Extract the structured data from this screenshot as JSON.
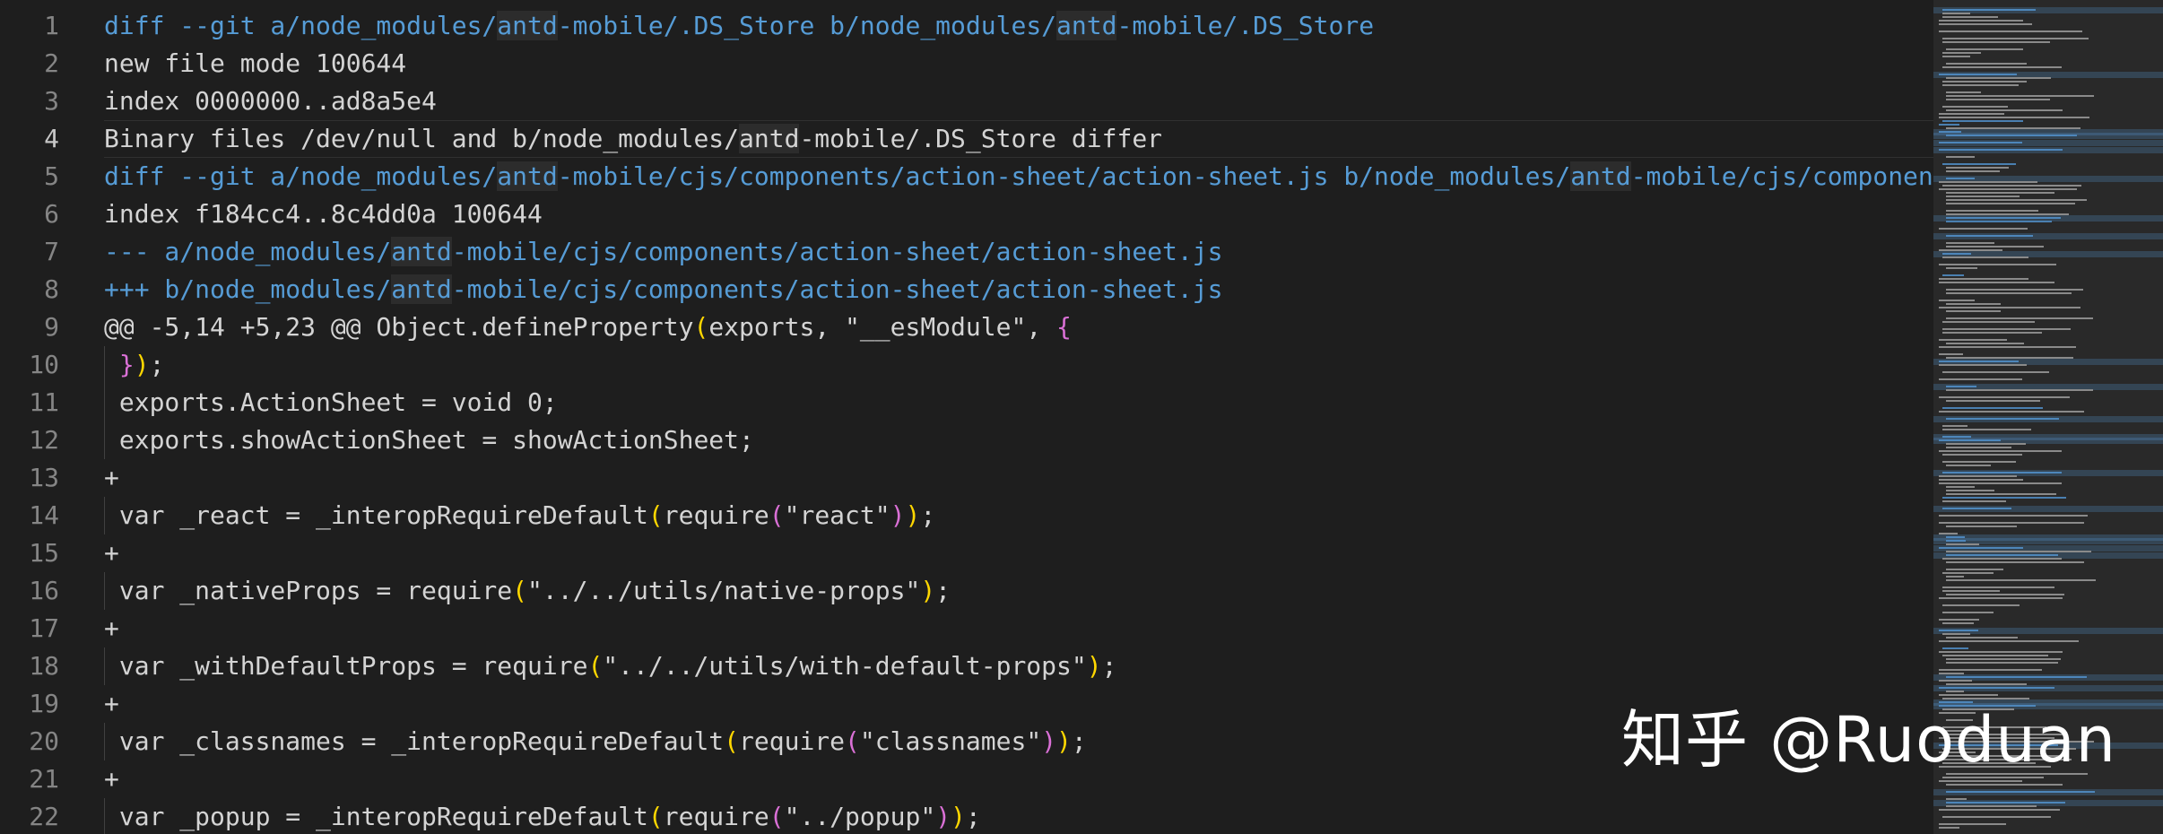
{
  "editor": {
    "line_numbers": [
      "1",
      "2",
      "3",
      "4",
      "5",
      "6",
      "7",
      "8",
      "9",
      "10",
      "11",
      "12",
      "13",
      "14",
      "15",
      "16",
      "17",
      "18",
      "19",
      "20",
      "21",
      "22"
    ],
    "active_line": 4,
    "lines": [
      {
        "segments": [
          {
            "t": "diff --git a/node_modules/",
            "c": "blue"
          },
          {
            "t": "antd",
            "c": "blue hl"
          },
          {
            "t": "-mobile/.DS_Store b/node_modules/",
            "c": "blue"
          },
          {
            "t": "antd",
            "c": "blue hl"
          },
          {
            "t": "-mobile/.DS_Store",
            "c": "blue"
          }
        ]
      },
      {
        "segments": [
          {
            "t": "new file mode 100644",
            "c": "kw"
          }
        ]
      },
      {
        "segments": [
          {
            "t": "index 0000000..ad8a5e4",
            "c": "kw"
          }
        ]
      },
      {
        "segments": [
          {
            "t": "Binary files /dev/null and b/node_modules/",
            "c": "kw"
          },
          {
            "t": "antd",
            "c": "kw hl"
          },
          {
            "t": "-mobile/.DS_Store differ",
            "c": "kw"
          }
        ]
      },
      {
        "segments": [
          {
            "t": "diff --git a/node_modules/",
            "c": "blue"
          },
          {
            "t": "antd",
            "c": "blue hl"
          },
          {
            "t": "-mobile/cjs/components/action-sheet/action-sheet.js b/node_modules/",
            "c": "blue"
          },
          {
            "t": "antd",
            "c": "blue hl"
          },
          {
            "t": "-mobile/cjs/componen",
            "c": "blue"
          }
        ]
      },
      {
        "segments": [
          {
            "t": "index f184cc4..8c4dd0a 100644",
            "c": "kw"
          }
        ]
      },
      {
        "segments": [
          {
            "t": "--- a/node_modules/",
            "c": "blue"
          },
          {
            "t": "antd",
            "c": "blue hl"
          },
          {
            "t": "-mobile/cjs/components/action-sheet/action-sheet.js",
            "c": "blue"
          }
        ]
      },
      {
        "segments": [
          {
            "t": "+++ b/node_modules/",
            "c": "blue"
          },
          {
            "t": "antd",
            "c": "blue hl"
          },
          {
            "t": "-mobile/cjs/components/action-sheet/action-sheet.js",
            "c": "blue"
          }
        ]
      },
      {
        "segments": [
          {
            "t": "@@ -5,14 +5,23 @@ Object.defineProperty",
            "c": "kw"
          },
          {
            "t": "(",
            "c": "p1"
          },
          {
            "t": "exports, \"__esModule\", ",
            "c": "kw"
          },
          {
            "t": "{",
            "c": "p2"
          }
        ]
      },
      {
        "segments": [
          {
            "t": " ",
            "c": "kw"
          },
          {
            "t": "}",
            "c": "p2"
          },
          {
            "t": ")",
            "c": "p1"
          },
          {
            "t": ";",
            "c": "kw"
          }
        ]
      },
      {
        "segments": [
          {
            "t": " exports.ActionSheet = void 0;",
            "c": "kw"
          }
        ]
      },
      {
        "segments": [
          {
            "t": " exports.showActionSheet = showActionSheet;",
            "c": "kw"
          }
        ]
      },
      {
        "segments": [
          {
            "t": "+",
            "c": "kw"
          }
        ]
      },
      {
        "segments": [
          {
            "t": " var _react = _interopRequireDefault",
            "c": "kw"
          },
          {
            "t": "(",
            "c": "p1"
          },
          {
            "t": "require",
            "c": "kw"
          },
          {
            "t": "(",
            "c": "p2"
          },
          {
            "t": "\"react\"",
            "c": "kw"
          },
          {
            "t": ")",
            "c": "p2"
          },
          {
            "t": ")",
            "c": "p1"
          },
          {
            "t": ";",
            "c": "kw"
          }
        ]
      },
      {
        "segments": [
          {
            "t": "+",
            "c": "kw"
          }
        ]
      },
      {
        "segments": [
          {
            "t": " var _nativeProps = require",
            "c": "kw"
          },
          {
            "t": "(",
            "c": "p1"
          },
          {
            "t": "\"../../utils/native-props\"",
            "c": "kw"
          },
          {
            "t": ")",
            "c": "p1"
          },
          {
            "t": ";",
            "c": "kw"
          }
        ]
      },
      {
        "segments": [
          {
            "t": "+",
            "c": "kw"
          }
        ]
      },
      {
        "segments": [
          {
            "t": " var _withDefaultProps = require",
            "c": "kw"
          },
          {
            "t": "(",
            "c": "p1"
          },
          {
            "t": "\"../../utils/with-default-props\"",
            "c": "kw"
          },
          {
            "t": ")",
            "c": "p1"
          },
          {
            "t": ";",
            "c": "kw"
          }
        ]
      },
      {
        "segments": [
          {
            "t": "+",
            "c": "kw"
          }
        ]
      },
      {
        "segments": [
          {
            "t": " var _classnames = _interopRequireDefault",
            "c": "kw"
          },
          {
            "t": "(",
            "c": "p1"
          },
          {
            "t": "require",
            "c": "kw"
          },
          {
            "t": "(",
            "c": "p2"
          },
          {
            "t": "\"classnames\"",
            "c": "kw"
          },
          {
            "t": ")",
            "c": "p2"
          },
          {
            "t": ")",
            "c": "p1"
          },
          {
            "t": ";",
            "c": "kw"
          }
        ]
      },
      {
        "segments": [
          {
            "t": "+",
            "c": "kw"
          }
        ]
      },
      {
        "segments": [
          {
            "t": " var _popup = _interopRequireDefault",
            "c": "kw"
          },
          {
            "t": "(",
            "c": "p1"
          },
          {
            "t": "require",
            "c": "kw"
          },
          {
            "t": "(",
            "c": "p2"
          },
          {
            "t": "\"../popup\"",
            "c": "kw"
          },
          {
            "t": ")",
            "c": "p2"
          },
          {
            "t": ")",
            "c": "p1"
          },
          {
            "t": ";",
            "c": "kw"
          }
        ]
      }
    ]
  },
  "watermark": {
    "text": "知乎 @Ruoduan"
  },
  "colors": {
    "background": "#1e1e1e",
    "diff_header": "#569cd6",
    "text": "#d4d4d4",
    "line_number": "#858585",
    "bracket_level1": "#ffd700",
    "bracket_level2": "#da70d6"
  }
}
